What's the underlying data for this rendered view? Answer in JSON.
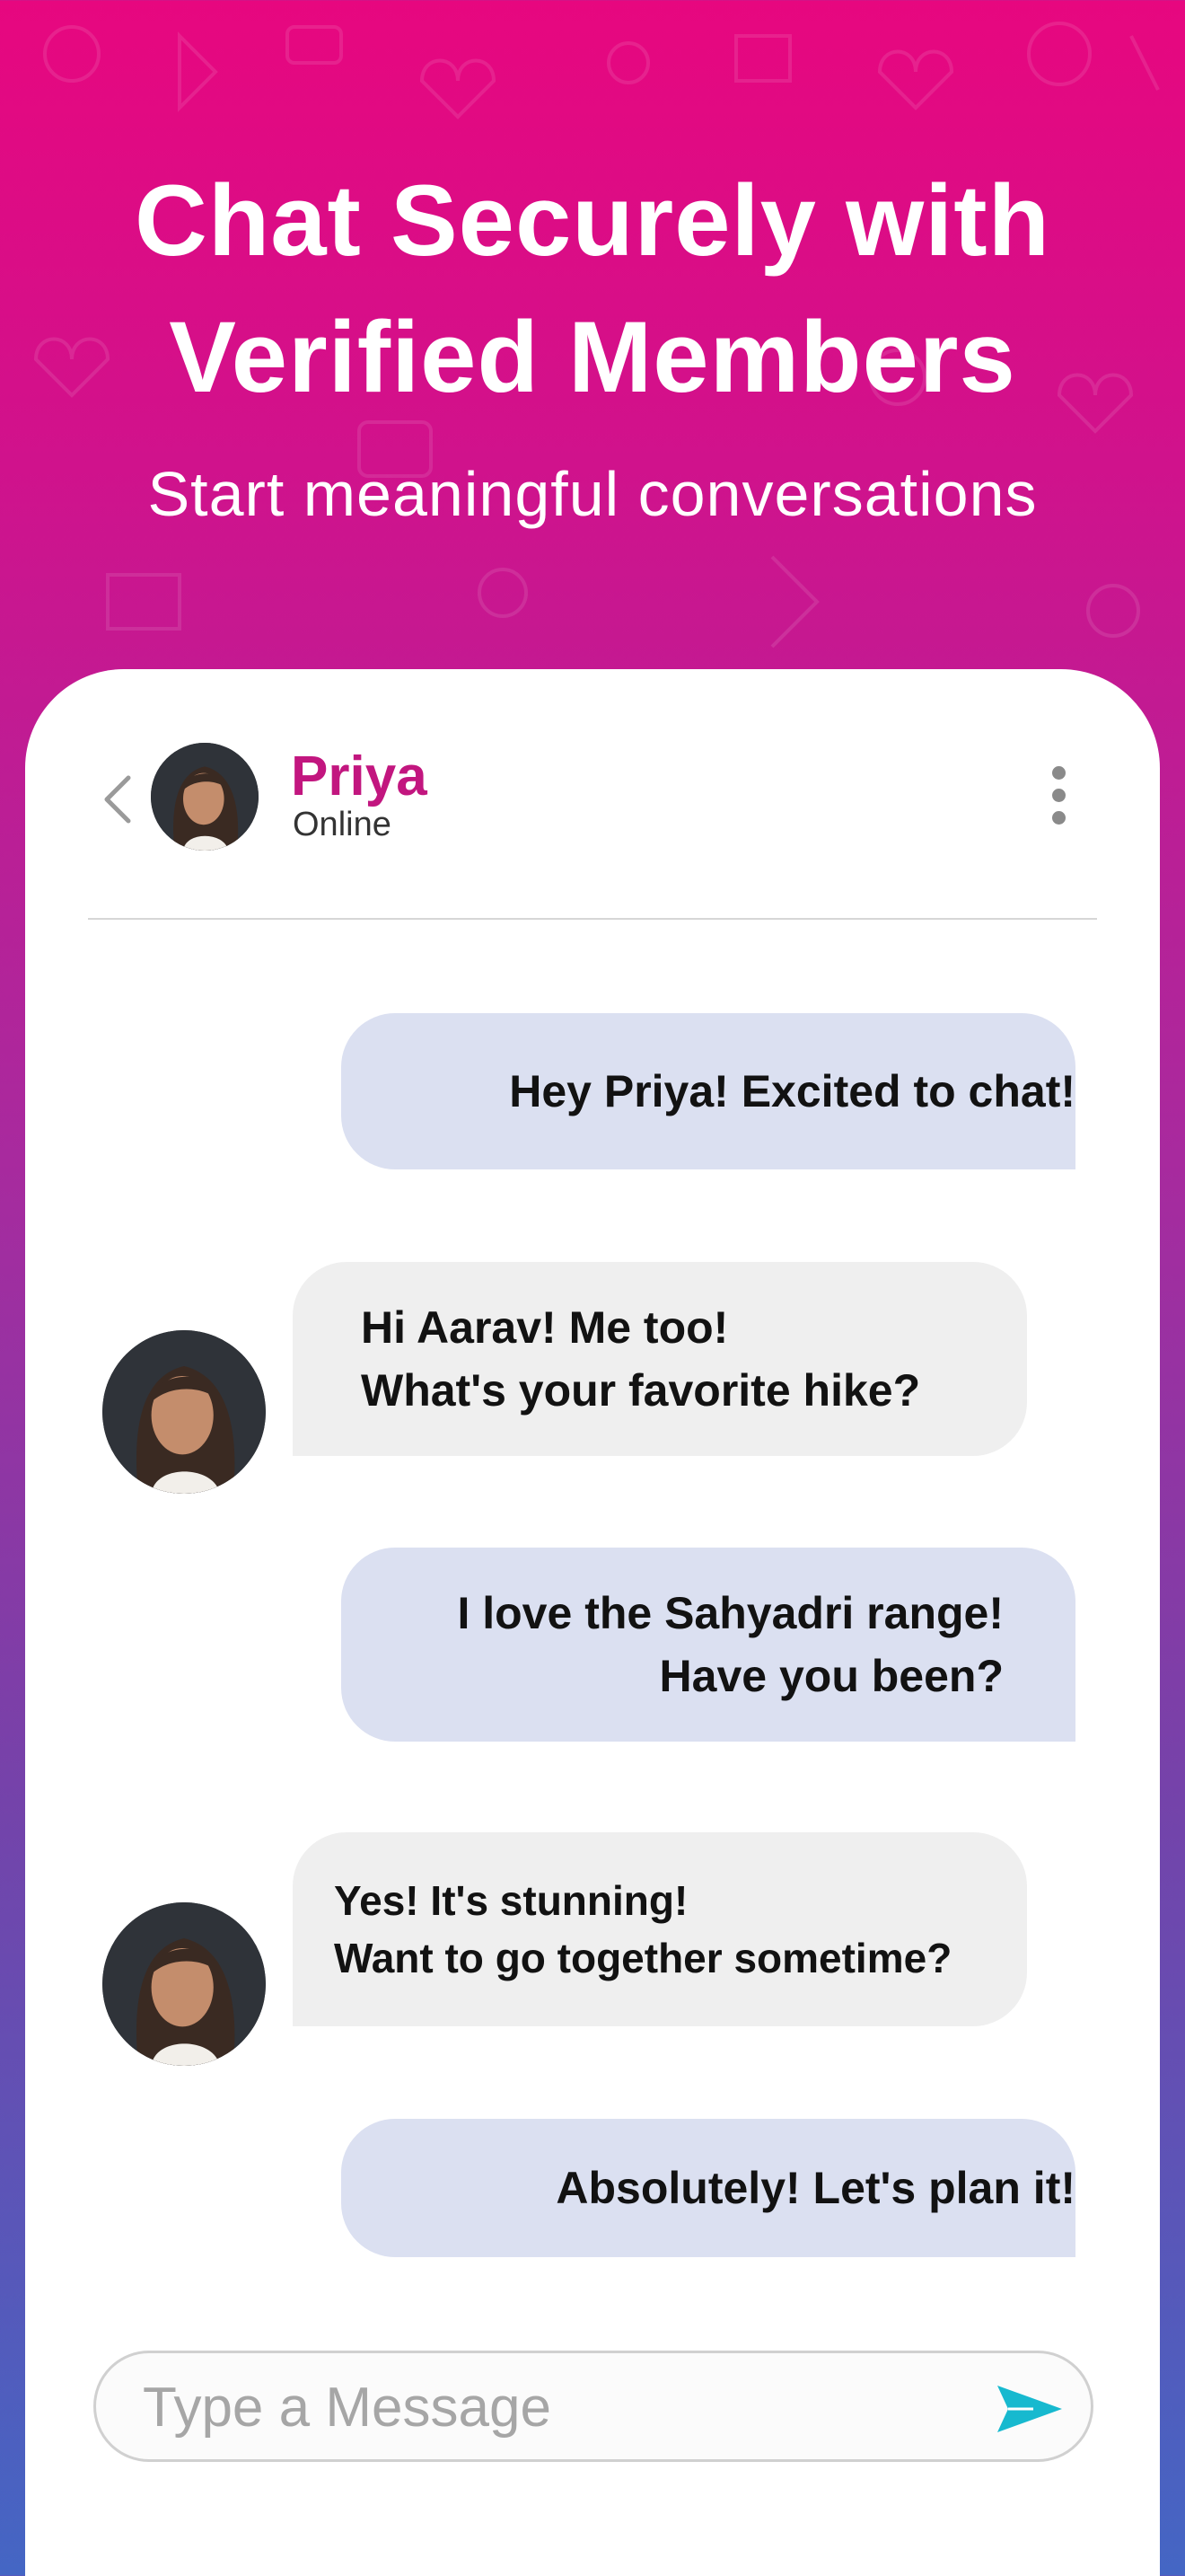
{
  "hero": {
    "title": "Chat Securely with Verified Members",
    "subtitle": "Start meaningful conversations"
  },
  "chat_header": {
    "back_icon": "chevron-left-icon",
    "contact_name": "Priya",
    "status": "Online",
    "menu_icon": "more-vertical-icon"
  },
  "messages": [
    {
      "direction": "sent",
      "text": "Hey Priya! Excited to chat!"
    },
    {
      "direction": "received",
      "text": "Hi Aarav! Me too!\nWhat's your favorite hike?"
    },
    {
      "direction": "sent",
      "text": "I love the Sahyadri range!\nHave you been?"
    },
    {
      "direction": "received",
      "text": "Yes! It's stunning!\nWant to go together sometime?"
    },
    {
      "direction": "sent",
      "text": "Absolutely! Let's plan it!"
    }
  ],
  "composer": {
    "placeholder": "Type a Message",
    "send_icon": "send-icon"
  },
  "colors": {
    "gradient_top": "#e7077f",
    "gradient_bottom": "#4466c4",
    "name_accent": "#c2167f",
    "sent_bubble": "#dbe0f1",
    "received_bubble": "#efefef",
    "send_icon": "#17b9cf"
  }
}
